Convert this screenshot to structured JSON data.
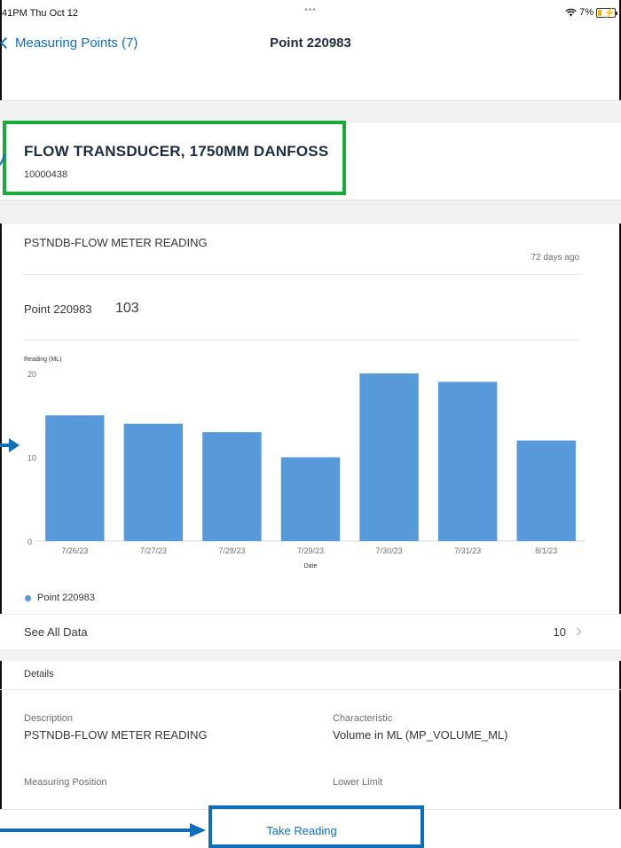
{
  "status_bar": {
    "time": "41PM  Thu Oct 12",
    "dots": "•••",
    "battery_percent": "7%"
  },
  "nav": {
    "back_label": "Measuring Points (7)",
    "title": "Point 220983"
  },
  "object_header": {
    "title": "FLOW TRANSDUCER, 1750MM DANFOSS",
    "subtitle": "10000438"
  },
  "card": {
    "title": "PSTNDB-FLOW METER READING",
    "time_ago": "72 days ago",
    "kpi_label": "Point 220983",
    "kpi_value": "103"
  },
  "chart_data": {
    "type": "bar",
    "ylabel": "Reading (ML)",
    "xlabel": "Date",
    "ylim": [
      0,
      20
    ],
    "yticks": [
      0,
      10,
      20
    ],
    "categories": [
      "7/26/23",
      "7/27/23",
      "7/28/23",
      "7/29/23",
      "7/30/23",
      "7/31/23",
      "8/1/23"
    ],
    "series": [
      {
        "name": "Point 220983",
        "values": [
          15,
          14,
          13,
          10,
          20,
          19,
          12
        ],
        "color": "#5899da"
      }
    ],
    "legend_position": "bottom-left",
    "grid": false
  },
  "legend": {
    "label": "Point 220983"
  },
  "see_all": {
    "label": "See All Data",
    "count": "10"
  },
  "details": {
    "header": "Details",
    "description_label": "Description",
    "description_value": "PSTNDB-FLOW METER READING",
    "characteristic_label": "Characteristic",
    "characteristic_value": "Volume in ML (MP_VOLUME_ML)",
    "measuring_position_label": "Measuring Position",
    "lower_limit_label": "Lower Limit"
  },
  "footer": {
    "take_reading_label": "Take Reading"
  },
  "colors": {
    "accent": "#0a6ed1",
    "bar": "#5899da",
    "highlight_green": "#1aab3c",
    "highlight_blue": "#0e6eb8"
  }
}
